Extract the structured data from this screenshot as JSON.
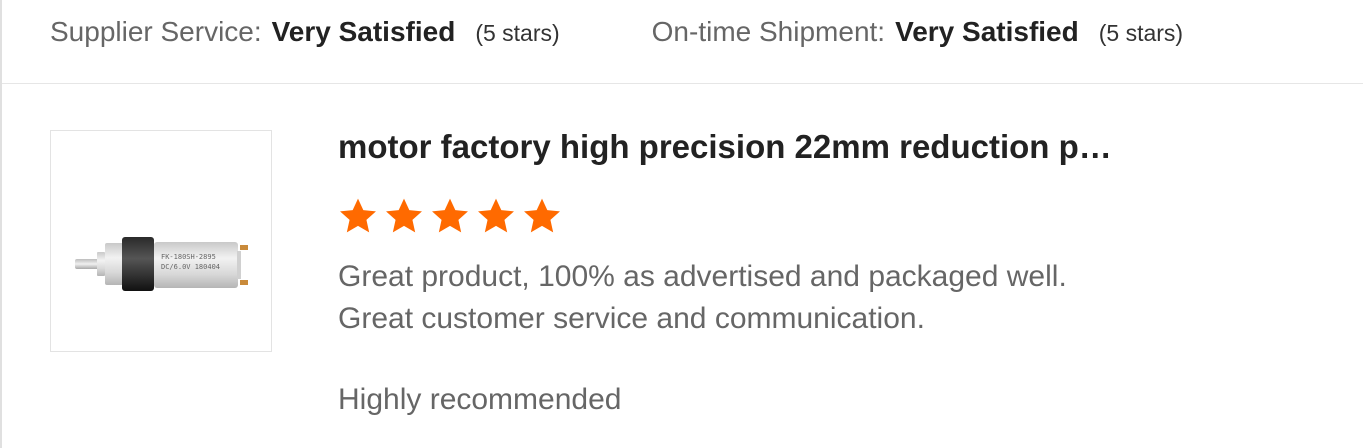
{
  "ratings": {
    "supplier_service": {
      "label": "Supplier Service:",
      "value": "Very Satisfied",
      "stars_text": "(5 stars)"
    },
    "ontime_shipment": {
      "label": "On-time Shipment:",
      "value": "Very Satisfied",
      "stars_text": "(5 stars)"
    }
  },
  "review": {
    "product_title": "motor factory high precision 22mm reduction p…",
    "rating": 5,
    "star_color": "#ff6a00",
    "text_line1": "Great product, 100% as advertised and packaged well.",
    "text_line2": "Great customer service and communication.",
    "text_line3": "Highly recommended"
  },
  "product_image": {
    "label_line1": "FK-180SH-2895",
    "label_line2": "DC/6.0V 180404"
  }
}
